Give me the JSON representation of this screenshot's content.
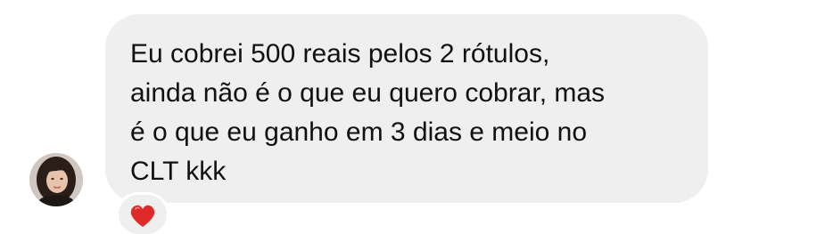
{
  "message": {
    "lines": [
      "Eu cobrei 500 reais pelos 2 rótulos,",
      "ainda não é o que eu quero cobrar, mas",
      "é o que eu ganho em 3 dias e meio no",
      "CLT kkk"
    ]
  },
  "reaction": {
    "icon": "red-heart-icon",
    "color": "#e02a2a"
  },
  "colors": {
    "bubble": "#efefef",
    "text": "#111111",
    "background": "#ffffff"
  }
}
